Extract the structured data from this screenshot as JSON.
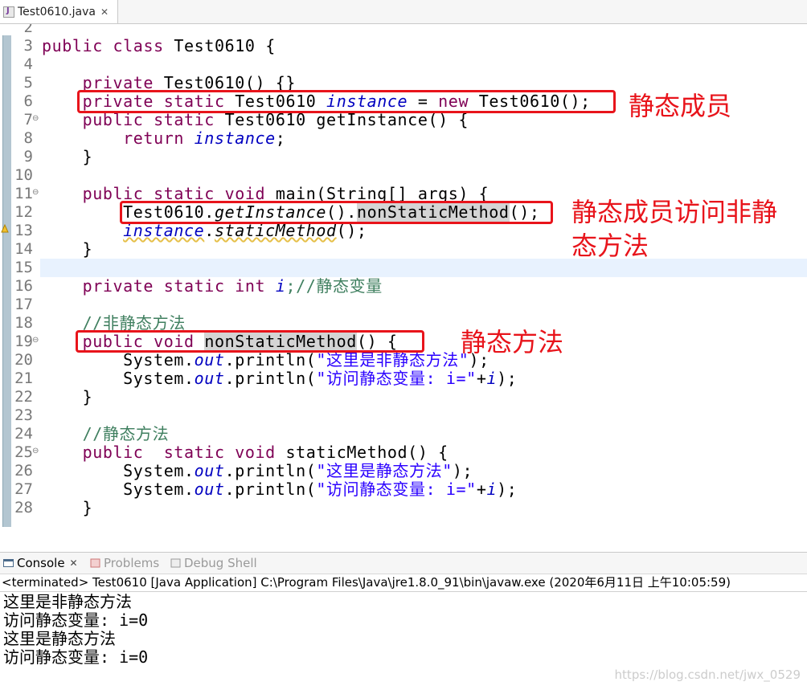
{
  "editor_tab": {
    "title": "Test0610.java",
    "close": "✕"
  },
  "code_lines": [
    {
      "n": "2"
    },
    {
      "n": "3"
    },
    {
      "n": "4"
    },
    {
      "n": "5"
    },
    {
      "n": "6"
    },
    {
      "n": "7"
    },
    {
      "n": "8"
    },
    {
      "n": "9"
    },
    {
      "n": "10"
    },
    {
      "n": "11"
    },
    {
      "n": "12"
    },
    {
      "n": "13"
    },
    {
      "n": "14"
    },
    {
      "n": "15"
    },
    {
      "n": "16"
    },
    {
      "n": "17"
    },
    {
      "n": "18"
    },
    {
      "n": "19"
    },
    {
      "n": "20"
    },
    {
      "n": "21"
    },
    {
      "n": "22"
    },
    {
      "n": "23"
    },
    {
      "n": "24"
    },
    {
      "n": "25"
    },
    {
      "n": "26"
    },
    {
      "n": "27"
    },
    {
      "n": "28"
    }
  ],
  "code": {
    "public": "public",
    "class": "class",
    "private": "private",
    "static": "static",
    "new": "new",
    "return": "return",
    "void": "void",
    "int": "int",
    "cls": "Test0610",
    "open_brace": "{",
    "close_brace": "}",
    "ctor": "Test0610() {}",
    "instance": "instance",
    "assign": "=",
    "ctor_call": "Test0610();",
    "getInstance_decl": "getInstance() {",
    "semicolon": ";",
    "main_decl": "main(String[] args) {",
    "dot": ".",
    "getInstance_call": "getInstance",
    "paren_dot": "().",
    "nonStaticMethod": "nonStaticMethod",
    "call_end": "();",
    "staticMethod_call": "staticMethod",
    "i": "i",
    "comment_static_var": ";//静态变量",
    "comment_non_static": "//非静态方法",
    "decl_tail": "() {",
    "system": "System.",
    "out": "out",
    "println_open": ".println(",
    "str1": "\"这里是非静态方法\"",
    "str2": "\"访问静态变量: i=\"",
    "str3": "\"这里是静态方法\"",
    "plus": "+",
    "close_paren_semi": ");",
    "comment_static_method": "//静态方法",
    "staticMethod_decl": "staticMethod() {"
  },
  "annotations": {
    "static_member": "静态成员",
    "static_access_non_static_1": "静态成员访问非静",
    "static_access_non_static_2": "态方法",
    "static_method": "静态方法"
  },
  "views": {
    "console": "Console",
    "console_close": "✕",
    "problems": "Problems",
    "debug_shell": "Debug Shell"
  },
  "status_line": "<terminated> Test0610 [Java Application] C:\\Program Files\\Java\\jre1.8.0_91\\bin\\javaw.exe (2020年6月11日 上午10:05:59)",
  "console_output": [
    "这里是非静态方法",
    "访问静态变量: i=0",
    "这里是静态方法",
    "访问静态变量: i=0"
  ],
  "watermark": "https://blog.csdn.net/jwx_0529",
  "colors": {
    "keyword": "#7f0055",
    "field": "#0000c0",
    "comment": "#3f7f5f",
    "string": "#2a00ff",
    "annotation_red": "#e8141b"
  }
}
